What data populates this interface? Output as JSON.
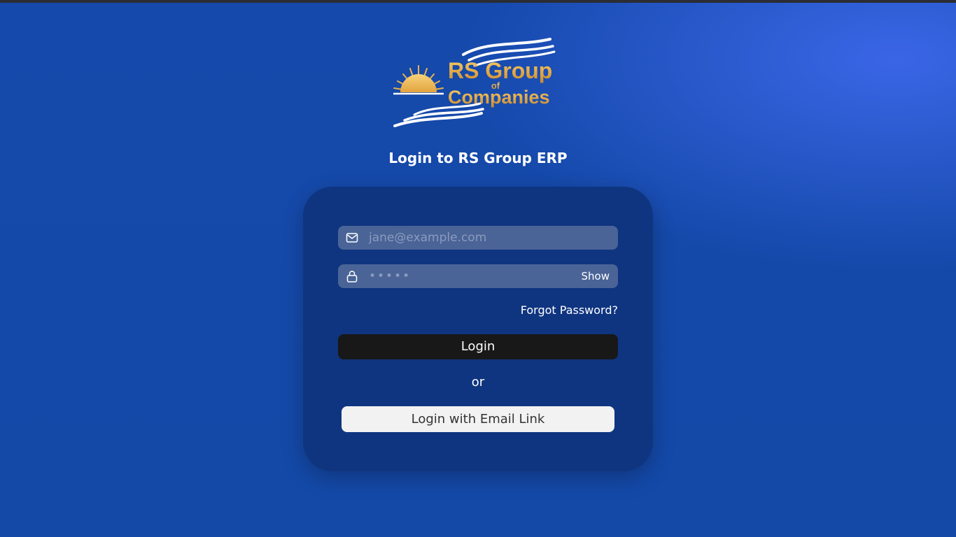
{
  "branding": {
    "logo_line1": "RS Group",
    "logo_line2": "of",
    "logo_line3": "Companies"
  },
  "page_title": "Login to RS Group ERP",
  "form": {
    "email": {
      "placeholder": "jane@example.com",
      "value": "",
      "icon": "mail-icon"
    },
    "password": {
      "placeholder": "•••••",
      "value": "",
      "icon": "lock-icon",
      "toggle_label": "Show"
    },
    "forgot_password_label": "Forgot Password?",
    "login_label": "Login",
    "divider_text": "or",
    "email_link_label": "Login with Email Link"
  },
  "colors": {
    "background": "#1449a8",
    "background_glow": "#3a66e6",
    "card": "#0f3580",
    "input_fill": "#4a6497",
    "primary_button": "#181818",
    "secondary_button": "#f2f2f2",
    "logo_gold": "#e8b454"
  }
}
